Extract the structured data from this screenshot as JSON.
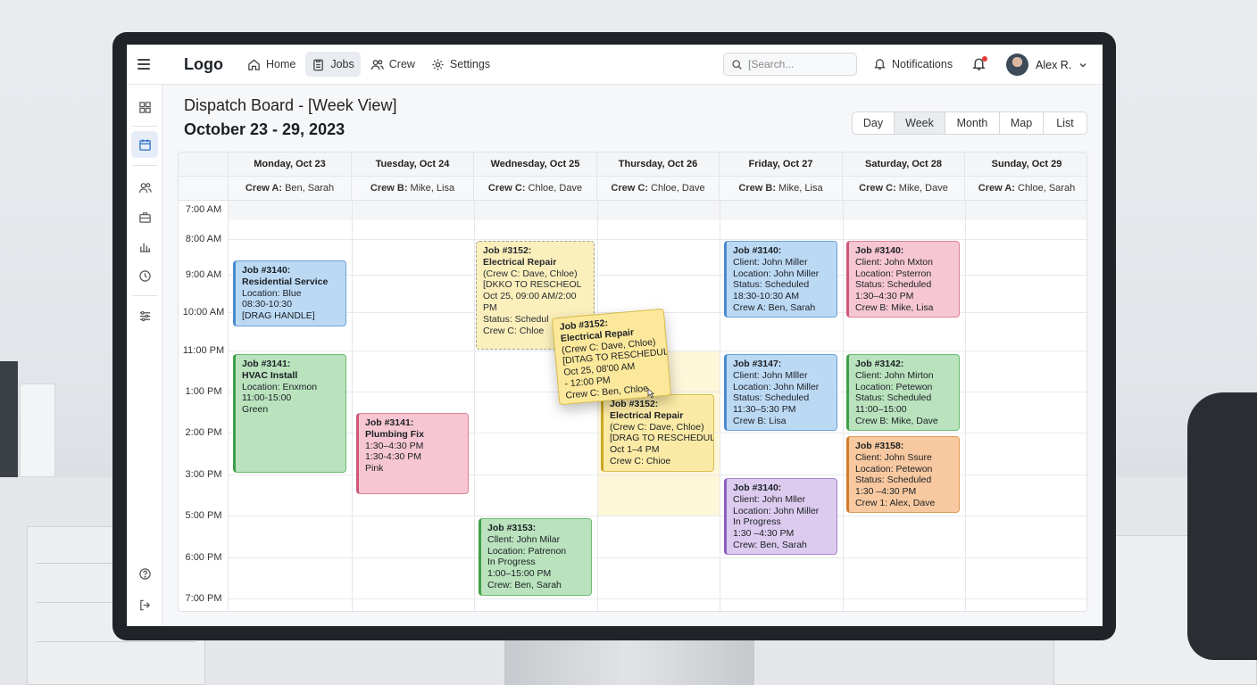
{
  "topbar": {
    "logo": "Logo",
    "nav": [
      {
        "label": "Home",
        "icon": "home-icon"
      },
      {
        "label": "Jobs",
        "icon": "clipboard-icon",
        "active": true
      },
      {
        "label": "Crew",
        "icon": "users-icon"
      },
      {
        "label": "Settings",
        "icon": "gear-icon"
      }
    ],
    "search_placeholder": "[Search...",
    "notifications_label": "Notifications",
    "user_name": "Alex R."
  },
  "header": {
    "title": "Dispatch Board - [Week View]",
    "date_range": "October 23 - 29, 2023"
  },
  "view_toggle": [
    "Day",
    "Week",
    "Month",
    "Map",
    "List"
  ],
  "view_active": "Week",
  "days": [
    {
      "label": "Monday, Oct 23",
      "crew": "Crew A:",
      "members": " Ben, Sarah"
    },
    {
      "label": "Tuesday, Oct 24",
      "crew": "Crew B:",
      "members": " Mike, Lisa"
    },
    {
      "label": "Wednesday, Oct 25",
      "crew": "Crew C:",
      "members": " Chloe, Dave"
    },
    {
      "label": "Thursday, Oct 26",
      "crew": "Crew C:",
      "members": " Chloe, Dave"
    },
    {
      "label": "Friday, Oct 27",
      "crew": "Crew B:",
      "members": " Mike, Lisa"
    },
    {
      "label": "Saturday, Oct 28",
      "crew": "Crew C:",
      "members": " Mike, Dave"
    },
    {
      "label": "Sunday, Oct 29",
      "crew": "Crew A:",
      "members": " Chloe, Sarah"
    }
  ],
  "times": [
    "7:00 AM",
    "8:00 AM",
    "9:00 AM",
    "10:00 AM",
    "11:00 PM",
    "1:00 PM",
    "2:00 PM",
    "3:00 PM",
    "5:00 PM",
    "6:00 PM",
    "7:00 PM"
  ],
  "jobs": [
    {
      "id": "mon-3140",
      "lines": [
        "Job #3140:",
        "Residential Service",
        "Location: Blue",
        "08:30-10:30",
        "[DRAG HANDLE]"
      ],
      "bold": 2
    },
    {
      "id": "mon-3141",
      "lines": [
        "Job #3141:",
        "HVAC Install",
        "Location: Enxmon",
        "11:00-15:00",
        "Green"
      ],
      "bold": 2
    },
    {
      "id": "tue-3141",
      "lines": [
        "Job #3141:",
        "Plumbing Fix",
        "1:30–4:30 PM",
        "1:30-4:30 PM",
        "Pink"
      ],
      "bold": 2
    },
    {
      "id": "wed-3152-ghost",
      "lines": [
        "Job #3152:",
        "Electrical Repair",
        "(Crew C: Dave, Chloe)",
        "[DKKO TO RESCHEOL",
        " Oct 25, 09:00 AM/2:00",
        "PM",
        "Status: Schedul",
        "Crew C: Chloe"
      ],
      "bold": 2
    },
    {
      "id": "wed-3153",
      "lines": [
        "Job #3153:",
        "Cllent: John Milar",
        "Location: Patrenon",
        "In Progress",
        "1:00–15:00 PM",
        "Crew: Ben, Sarah"
      ],
      "bold": 1
    },
    {
      "id": "drag-3152",
      "lines": [
        "Job #3152:",
        "Electrical Repair",
        "(Crew C: Dave, Chloe)",
        "[DITAG TO RESCHEDULE)",
        "Oct 25, 08'00 AM",
        "- 12:00 PM",
        "Crew C: Ben, Chloe"
      ],
      "bold": 2
    },
    {
      "id": "thu-3152",
      "lines": [
        "Job #3152:",
        "Electrical Repair",
        "(Crew C: Dave, Chloe)",
        "[DRAG TO RESCHEDULE]",
        "Oct 1–4 PM",
        "Crew C: Chioe"
      ],
      "bold": 2
    },
    {
      "id": "fri-3140a",
      "lines": [
        "Job #3140:",
        "Client: John Miller",
        "Location: John Miller",
        "Status: Scheduled",
        "18:30-10:30 AM",
        "Crew A: Ben, Sarah"
      ],
      "bold": 1
    },
    {
      "id": "fri-3147",
      "lines": [
        "Job #3147:",
        "Client: John Mlller",
        "Location: John Miller",
        "Status: Scheduled",
        "11:30–5:30 PM",
        "Crew B: Lisa"
      ],
      "bold": 1
    },
    {
      "id": "fri-3140b",
      "lines": [
        "Job #3140:",
        "Client: John Mller",
        "Location: John Miller",
        "In Progress",
        "1:30 –4:30 PM",
        "Crew: Ben, Sarah"
      ],
      "bold": 1
    },
    {
      "id": "sat-3140",
      "lines": [
        "Job #3140:",
        "Client: John Mxton",
        "Location: Psterron",
        "Status: Scheduled",
        "1:30–4:30 PM",
        "Crew B: Mike, Lisa"
      ],
      "bold": 1
    },
    {
      "id": "sat-3142",
      "lines": [
        "Job #3142:",
        "Client: John Mirton",
        "Location: Petewon",
        "Status: Scheduled",
        "11:00–15:00",
        "Crew B: Mike, Dave"
      ],
      "bold": 1
    },
    {
      "id": "sat-3158",
      "lines": [
        "Job #3158:",
        "Client: John Ssure",
        "Location: Petewon",
        "Status: Scheduled",
        "1:30 –4:30 PM",
        "Crew 1: Alex, Dave"
      ],
      "bold": 1
    }
  ],
  "colors": {
    "blue": "#bcd9f4",
    "green": "#b9e2bd",
    "pink": "#f6c7d2",
    "yellow": "#fbeaa5",
    "purple": "#dccbee",
    "orange": "#f8c9a0"
  }
}
